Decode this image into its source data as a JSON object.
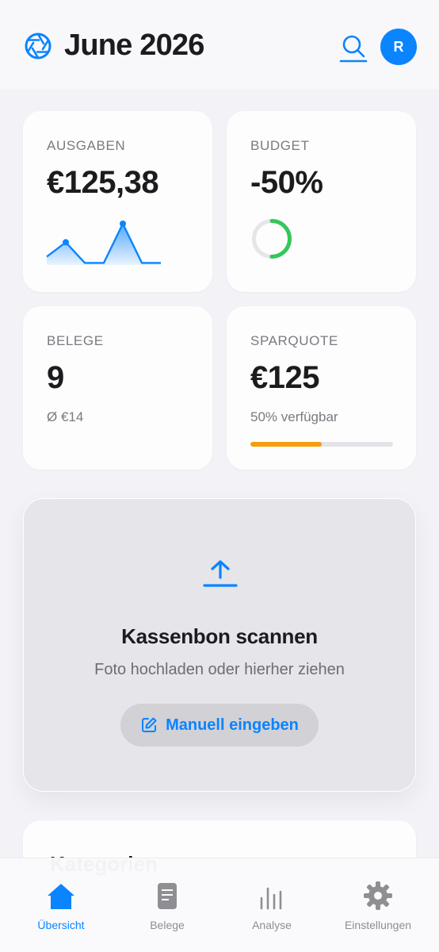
{
  "header": {
    "title": "June 2026",
    "avatar_initial": "R",
    "logo_icon": "aperture-icon",
    "search_icon": "search-icon"
  },
  "stats": {
    "ausgaben": {
      "label": "AUSGABEN",
      "value": "€125,38",
      "sparkline": [
        0.2,
        0.55,
        0.05,
        0.05,
        1.0,
        0.05,
        0.05
      ]
    },
    "budget": {
      "label": "BUDGET",
      "value": "-50%",
      "ring_progress": 0.5,
      "ring_color": "#34c759"
    },
    "belege": {
      "label": "BELEGE",
      "value": "9",
      "sub": "Ø €14"
    },
    "sparquote": {
      "label": "SPARQUOTE",
      "value": "€125",
      "sub": "50% verfügbar",
      "progress": 0.5,
      "progress_color": "#f59e0b"
    }
  },
  "scan": {
    "title": "Kassenbon scannen",
    "subtitle": "Foto hochladen oder hierher ziehen",
    "manual_button": "Manuell eingeben",
    "upload_icon": "upload-icon",
    "edit_icon": "edit-icon"
  },
  "kategorien": {
    "title": "Kategorien"
  },
  "tabbar": {
    "items": [
      {
        "label": "Übersicht",
        "icon": "home-icon",
        "active": true
      },
      {
        "label": "Belege",
        "icon": "document-icon",
        "active": false
      },
      {
        "label": "Analyse",
        "icon": "chart-icon",
        "active": false
      },
      {
        "label": "Einstellungen",
        "icon": "gear-icon",
        "active": false
      }
    ]
  },
  "colors": {
    "accent": "#0a84ff",
    "background": "#f2f2f7",
    "success": "#34c759",
    "warning": "#f59e0b"
  }
}
